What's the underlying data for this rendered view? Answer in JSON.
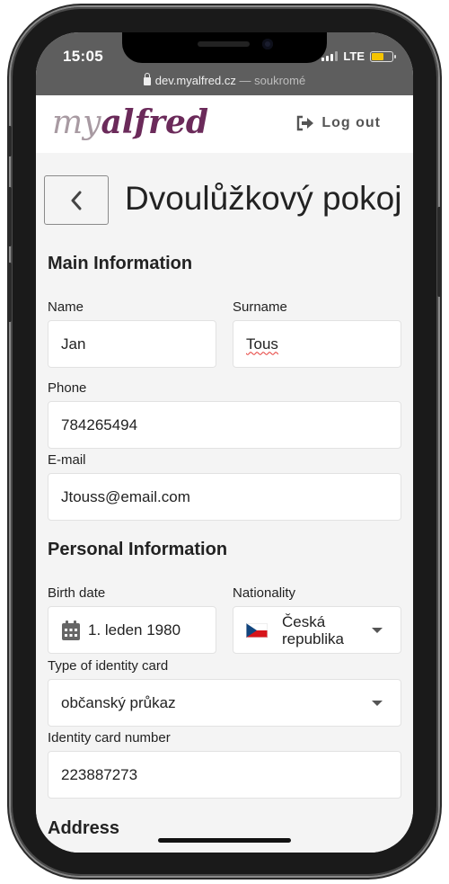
{
  "status_bar": {
    "time": "15:05",
    "network": "LTE",
    "battery_level": 0.6,
    "battery_color": "#f5c400"
  },
  "browser": {
    "url": "dev.myalfred.cz",
    "separator": " — ",
    "mode": "soukromé"
  },
  "header": {
    "logo_my": "my",
    "logo_alfred": "alfred",
    "logout_label": "Log out",
    "logout_icon": "sign-out-icon",
    "brand_color": "#6b2a5a"
  },
  "page": {
    "back_icon": "chevron-left-icon",
    "title": "Dvoulůžkový pokoj"
  },
  "main_information": {
    "title": "Main Information",
    "name_label": "Name",
    "name_value": "Jan",
    "surname_label": "Surname",
    "surname_value": "Tous",
    "phone_label": "Phone",
    "phone_value": "784265494",
    "email_label": "E-mail",
    "email_value": "Jtouss@email.com"
  },
  "personal_information": {
    "title": "Personal Information",
    "birth_date_label": "Birth date",
    "birth_date_value": "1. leden 1980",
    "calendar_icon": "calendar-icon",
    "nationality_label": "Nationality",
    "nationality_value_line1": "Česká",
    "nationality_value_line2": "republika",
    "flag_icon": "czech-flag-icon",
    "id_type_label": "Type of identity card",
    "id_type_value": "občanský průkaz",
    "id_number_label": "Identity card number",
    "id_number_value": "223887273"
  },
  "address": {
    "title": "Address"
  }
}
